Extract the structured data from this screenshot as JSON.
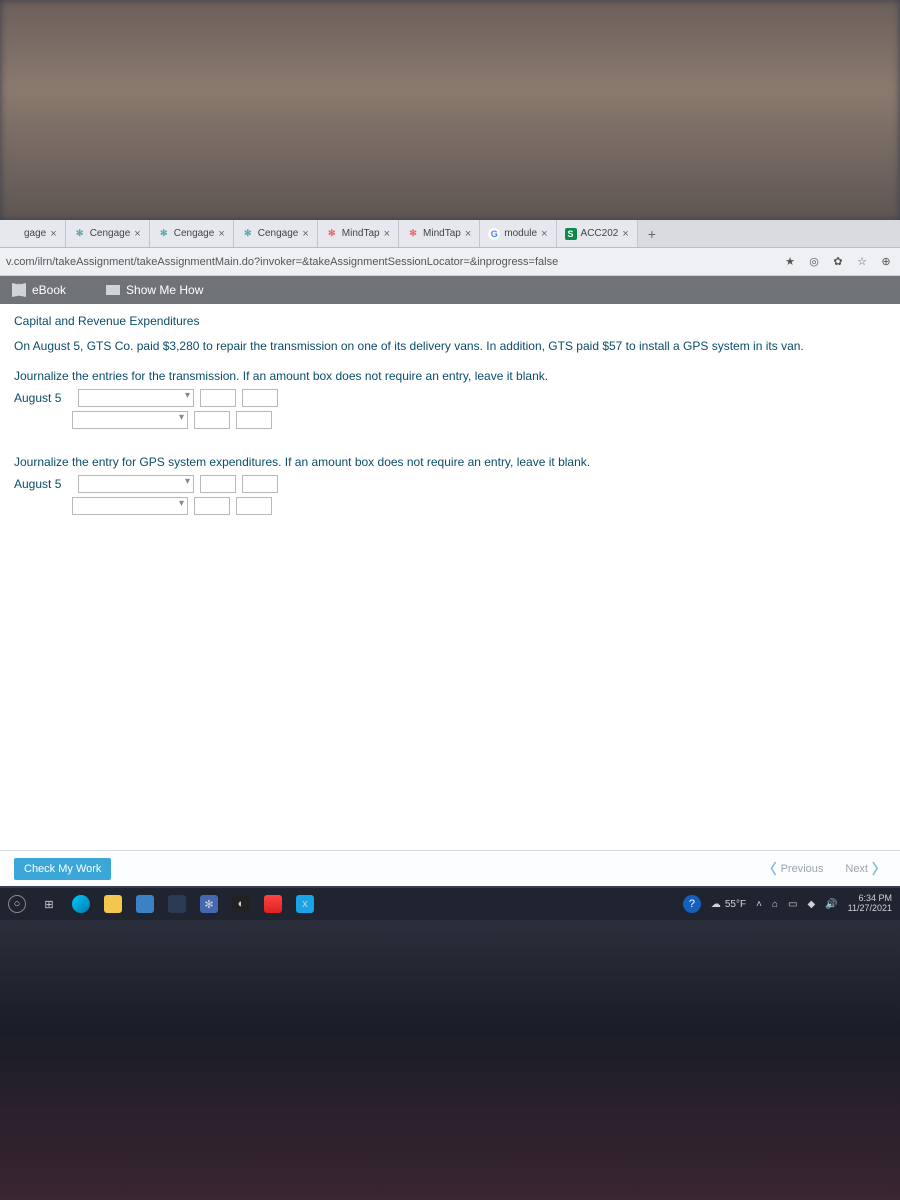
{
  "tabs": [
    {
      "label": "gage",
      "favicon": "",
      "favcolor": "#999"
    },
    {
      "label": "Cengage",
      "favicon": "✻",
      "favcolor": "#5aa"
    },
    {
      "label": "Cengage",
      "favicon": "✻",
      "favcolor": "#5aa"
    },
    {
      "label": "Cengage",
      "favicon": "✻",
      "favcolor": "#5aa"
    },
    {
      "label": "MindTap",
      "favicon": "✻",
      "favcolor": "#e66"
    },
    {
      "label": "MindTap",
      "favicon": "✻",
      "favcolor": "#e66"
    },
    {
      "label": "module",
      "favicon": "G",
      "favcolor": "#4285f4"
    },
    {
      "label": "ACC202",
      "favicon": "S",
      "favcolor": "#0b8a4a"
    }
  ],
  "url": "v.com/ilrn/takeAssignment/takeAssignmentMain.do?invoker=&takeAssignmentSessionLocator=&inprogress=false",
  "toolbar": {
    "ebook": "eBook",
    "show_me": "Show Me How"
  },
  "assignment": {
    "title": "Capital and Revenue Expenditures",
    "problem": "On August 5, GTS Co. paid $3,280 to repair the transmission on one of its delivery vans. In addition, GTS paid $57 to install a GPS system in its van.",
    "instr1": "Journalize the entries for the transmission. If an amount box does not require an entry, leave it blank.",
    "date1": "August 5",
    "instr2": "Journalize the entry for GPS system expenditures. If an amount box does not require an entry, leave it blank.",
    "date2": "August 5"
  },
  "nav": {
    "check": "Check My Work",
    "prev": "Previous",
    "next": "Next"
  },
  "taskbar": {
    "weather": "55°F",
    "time": "6:34 PM",
    "date": "11/27/2021"
  }
}
